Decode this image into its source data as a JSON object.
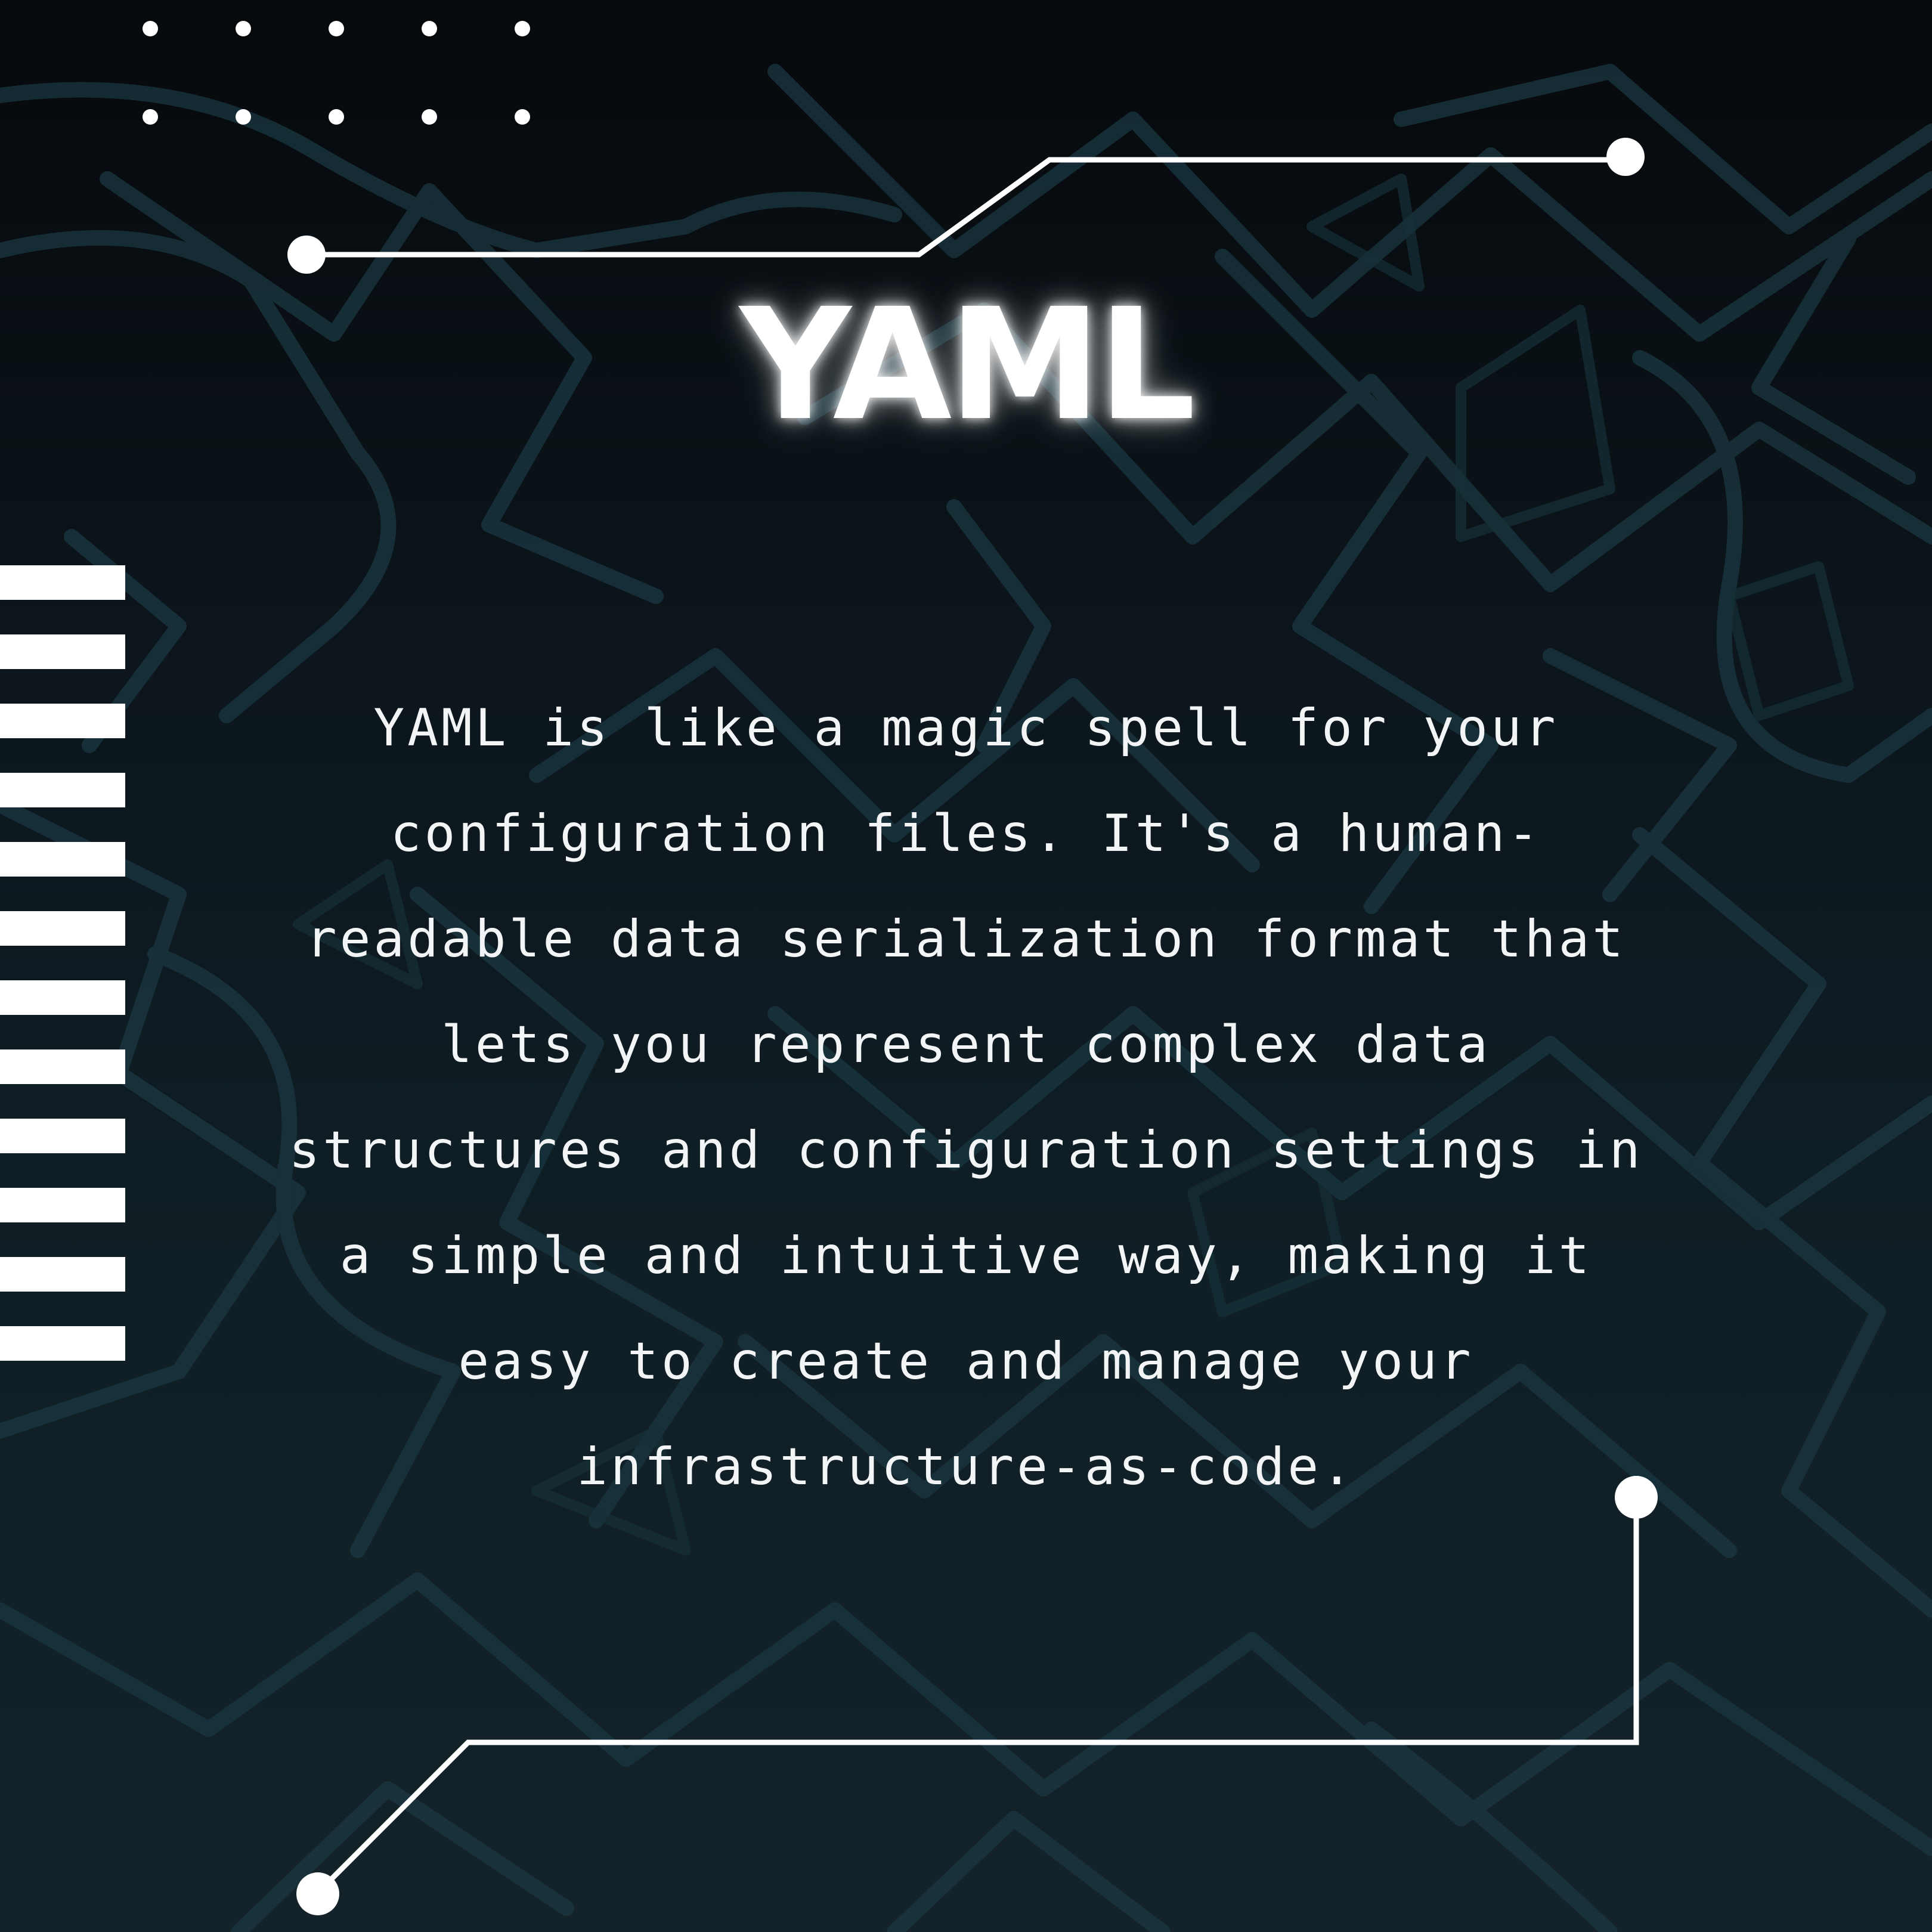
{
  "title": "YAML",
  "description_lines": [
    "YAML is like a magic spell for your",
    "configuration files. It's a human-",
    "readable data serialization format that",
    "lets you represent complex data",
    "structures and configuration settings in",
    "a simple and intuitive way, making it",
    "easy to create and manage your",
    "infrastructure-as-code."
  ],
  "colors": {
    "background_top": "#06090c",
    "background_bottom": "#14222a",
    "pattern_stroke": "#1c3a44",
    "accent": "#ffffff"
  },
  "decorations": {
    "dot_grid": "dot-grid-icon",
    "stripes": "stripe-bar-icon",
    "circuit": "circuit-line-icon"
  }
}
